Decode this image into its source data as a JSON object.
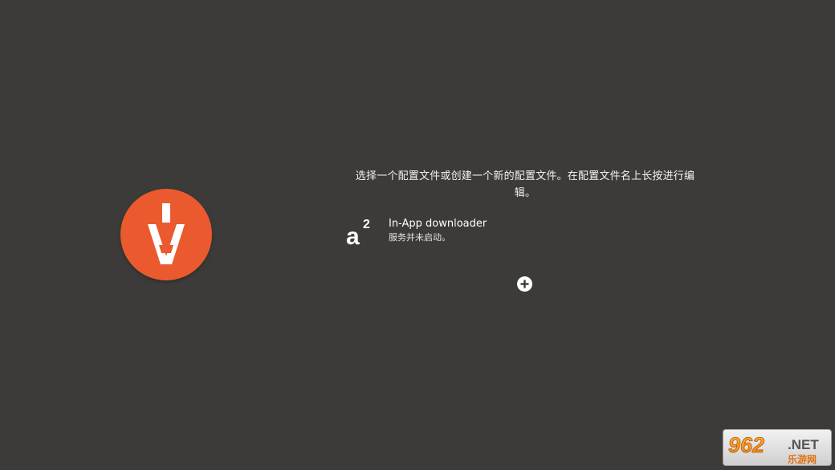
{
  "instruction": {
    "line1": "选择一个配置文件或创建一个新的配置文件。在配置文件名上长按进行编",
    "line2": "辑。"
  },
  "profiles": [
    {
      "name": "In-App downloader",
      "status": "服务并未启动。",
      "icon": "a2-icon"
    }
  ],
  "add_button": {
    "icon": "plus-circle-icon"
  },
  "logo": {
    "icon": "orange-app-logo-icon",
    "color": "#ea5a2e"
  },
  "watermark": {
    "brand": "962",
    "suffix": ".NET",
    "tagline": "乐游网"
  },
  "colors": {
    "background": "#3c3b39",
    "accent": "#ea5a2e",
    "text": "#ffffff"
  }
}
